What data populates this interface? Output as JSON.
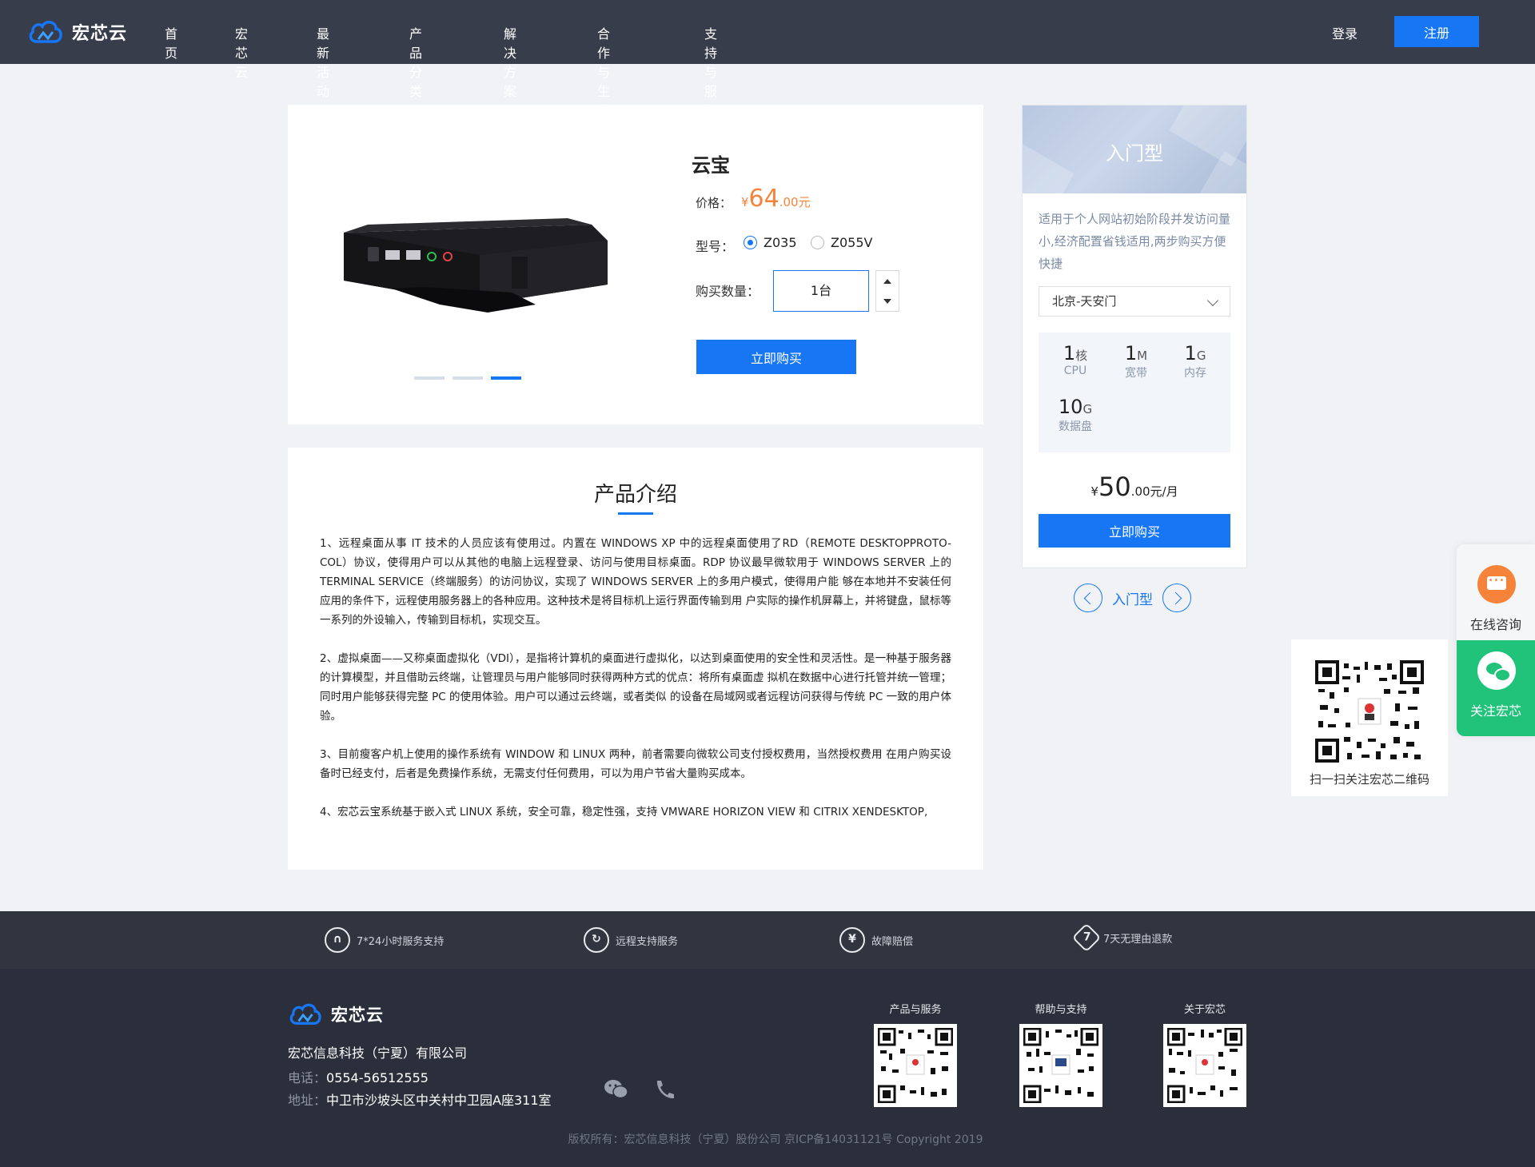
{
  "header": {
    "brand": "宏芯云",
    "nav": [
      "首页",
      "宏芯云",
      "最新活动",
      "产品分类",
      "解决方案",
      "合作与生态",
      "支持与服务"
    ],
    "login": "登录",
    "register": "注册"
  },
  "product": {
    "title": "云宝",
    "price_label": "价格：",
    "price_currency": "¥",
    "price_int": "64",
    "price_dec": ".00元",
    "model_label": "型号：",
    "models": [
      "Z035",
      "Z055V"
    ],
    "selected_model": "Z035",
    "qty_label": "购买数量：",
    "qty_value": "1台",
    "buy_label": "立即购买",
    "carousel_active_index": 2,
    "carousel_count": 3
  },
  "intro": {
    "title": "产品介绍",
    "paragraphs": [
      "1、远程桌面从事 IT 技术的人员应该有使用过。内置在 WINDOWS XP 中的远程桌面使用了RD（REMOTE DESKTOPPROTO-COL）协议，使得用户可以从其他的电脑上远程登录、访问与使用目标桌面。RDP 协议最早微软用于 WINDOWS SERVER 上的 TERMINAL SERVICE（终端服务）的访问协议，实现了 WINDOWS SERVER 上的多用户模式，使得用户能 够在本地并不安装任何应用的条件下，远程使用服务器上的各种应用。这种技术是将目标机上运行界面传输到用 户实际的操作机屏幕上，并将键盘，鼠标等一系列的外设输入，传输到目标机，实现交互。",
      "2、虚拟桌面——又称桌面虚拟化（VDI），是指将计算机的桌面进行虚拟化，以达到桌面使用的安全性和灵活性。是一种基于服务器的计算模型，并且借助云终端，让管理员与用户能够同时获得两种方式的优点：将所有桌面虚 拟机在数据中心进行托管并统一管理；同时用户能够获得完整 PC 的使用体验。用户可以通过云终端，或者类似 的设备在局域网或者远程访问获得与传统 PC 一致的用户体验。",
      "3、目前瘦客户机上使用的操作系统有 WINDOW 和 LINUX 两种，前者需要向微软公司支付授权费用，当然授权费用 在用户购买设备时已经支付，后者是免费操作系统，无需支付任何费用，可以为用户节省大量购买成本。",
      "4、宏芯云宝系统基于嵌入式 LINUX 系统，安全可靠，稳定性强，支持 VMWARE HORIZON VIEW 和 CITRIX XENDESKTOP,"
    ]
  },
  "plan": {
    "name": "入门型",
    "desc": "适用于个人网站初始阶段并发访问量小,经济配置省钱适用,两步购买方便快捷",
    "region": "北京-天安门",
    "specs": [
      {
        "num": "1",
        "unit": "核",
        "name": "CPU"
      },
      {
        "num": "1",
        "unit": "M",
        "name": "宽带"
      },
      {
        "num": "1",
        "unit": "G",
        "name": "内存"
      },
      {
        "num": "10",
        "unit": "G",
        "name": "数据盘"
      }
    ],
    "price_currency": "¥",
    "price_int": "50",
    "price_dec": ".00",
    "price_unit": "元/月",
    "buy_label": "立即购买",
    "switch_label": "入门型"
  },
  "float": {
    "consult": "在线咨询",
    "follow": "关注宏芯",
    "qr_caption": "扫一扫关注宏芯二维码"
  },
  "footer": {
    "features": [
      "7*24小时服务支持",
      "远程支持服务",
      "故障赔偿",
      "7天无理由退款"
    ],
    "feature_icons": [
      "headset-icon",
      "remote-icon",
      "yuan-icon",
      "seven-day-icon"
    ],
    "brand": "宏芯云",
    "company": "宏芯信息科技（宁夏）有限公司",
    "phone_label": "电话：",
    "phone": "0554-56512555",
    "address_label": "地址：",
    "address": "中卫市沙坡头区中关村中卫园A座311室",
    "qr_captions": [
      "产品与服务",
      "帮助与支持",
      "关于宏芯"
    ],
    "copyright": "版权所有：宏芯信息科技（宁夏）股份公司 京ICP备14031121号 Copyright 2019"
  },
  "colors": {
    "accent": "#1676f3",
    "header_bg": "#373d4a",
    "price_orange": "#f5843a",
    "follow_green": "#21c27a"
  }
}
